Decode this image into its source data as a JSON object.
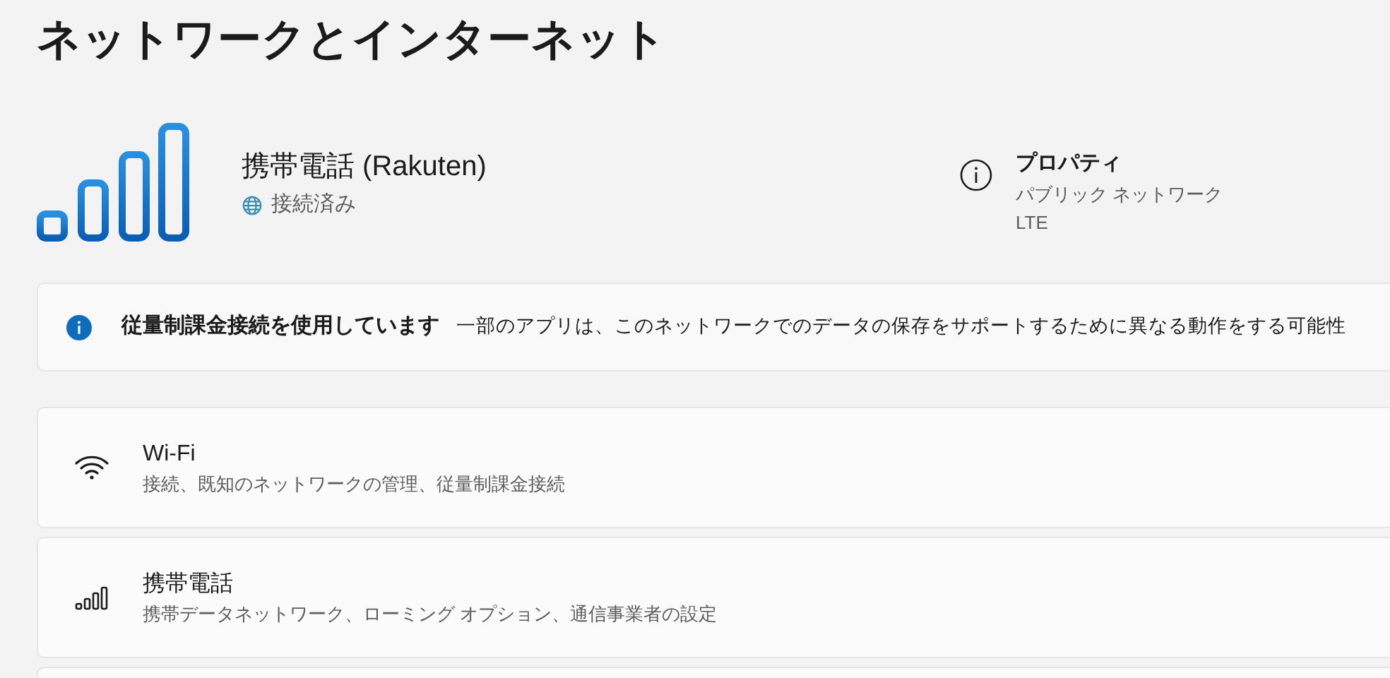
{
  "page_title": "ネットワークとインターネット",
  "connection": {
    "name": "携帯電話 (Rakuten)",
    "status": "接続済み",
    "properties": {
      "title": "プロパティ",
      "lines": [
        "パブリック ネットワーク",
        "LTE"
      ]
    }
  },
  "banner": {
    "title": "従量制課金接続を使用しています",
    "message": "一部のアプリは、このネットワークでのデータの保存をサポートするために異なる動作をする可能性"
  },
  "items": [
    {
      "kind": "wifi",
      "title": "Wi-Fi",
      "subtitle": "接続、既知のネットワークの管理、従量制課金接続"
    },
    {
      "kind": "cellular",
      "title": "携帯電話",
      "subtitle": "携帯データネットワーク、ローミング オプション、通信事業者の設定"
    }
  ]
}
